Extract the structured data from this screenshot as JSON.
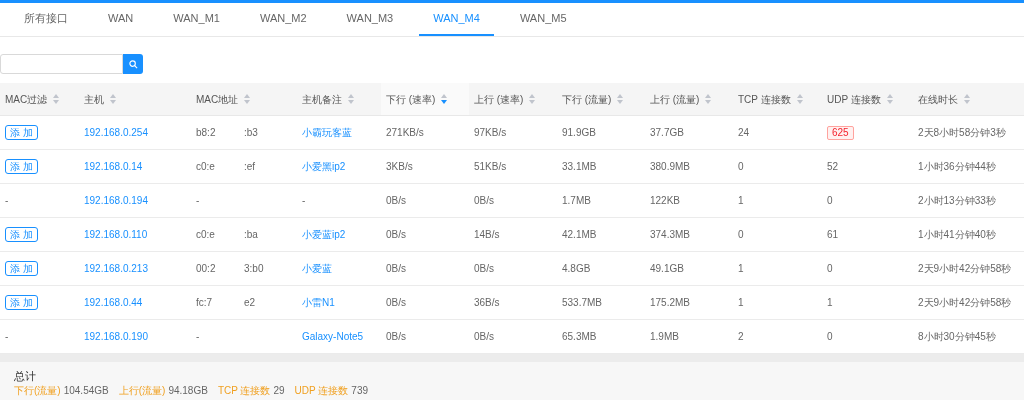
{
  "tabs": [
    {
      "label": "所有接口",
      "selected": false
    },
    {
      "label": "WAN",
      "selected": false
    },
    {
      "label": "WAN_M1",
      "selected": false
    },
    {
      "label": "WAN_M2",
      "selected": false
    },
    {
      "label": "WAN_M3",
      "selected": false
    },
    {
      "label": "WAN_M4",
      "selected": true
    },
    {
      "label": "WAN_M5",
      "selected": false
    }
  ],
  "table": {
    "columns": [
      {
        "label": "MAC过滤",
        "sorted": false
      },
      {
        "label": "主机",
        "sorted": false
      },
      {
        "label": "MAC地址",
        "sorted": false
      },
      {
        "label": "主机备注",
        "sorted": false
      },
      {
        "label": "下行 (速率)",
        "sorted": true
      },
      {
        "label": "上行 (速率)",
        "sorted": false
      },
      {
        "label": "下行 (流量)",
        "sorted": false
      },
      {
        "label": "上行 (流量)",
        "sorted": false
      },
      {
        "label": "TCP 连接数",
        "sorted": false
      },
      {
        "label": "UDP 连接数",
        "sorted": false
      },
      {
        "label": "在线时长",
        "sorted": false
      }
    ],
    "rows": [
      {
        "filter": {
          "kind": "button",
          "label": "添 加"
        },
        "host": "192.168.0.254",
        "mac": [
          "b8:2",
          ":b3"
        ],
        "note": "小霸玩客蓝",
        "down_rate": "271KB/s",
        "up_rate": "97KB/s",
        "down_total": "91.9GB",
        "up_total": "37.7GB",
        "tcp": "24",
        "udp": {
          "kind": "badge",
          "label": "625"
        },
        "online": "2天8小时58分钟3秒"
      },
      {
        "filter": {
          "kind": "button",
          "label": "添 加"
        },
        "host": "192.168.0.14",
        "mac": [
          "c0:e",
          ":ef"
        ],
        "note": "小爱黑ip2",
        "down_rate": "3KB/s",
        "up_rate": "51KB/s",
        "down_total": "33.1MB",
        "up_total": "380.9MB",
        "tcp": "0",
        "udp": {
          "kind": "text",
          "label": "52"
        },
        "online": "1小时36分钟44秒"
      },
      {
        "filter": {
          "kind": "text",
          "label": "-"
        },
        "host": "192.168.0.194",
        "mac": [
          "-"
        ],
        "note": "-",
        "down_rate": "0B/s",
        "up_rate": "0B/s",
        "down_total": "1.7MB",
        "up_total": "122KB",
        "tcp": "1",
        "udp": {
          "kind": "text",
          "label": "0"
        },
        "online": "2小时13分钟33秒"
      },
      {
        "filter": {
          "kind": "button",
          "label": "添 加"
        },
        "host": "192.168.0.110",
        "mac": [
          "c0:e",
          ":ba"
        ],
        "note": "小爱蓝ip2",
        "down_rate": "0B/s",
        "up_rate": "14B/s",
        "down_total": "42.1MB",
        "up_total": "374.3MB",
        "tcp": "0",
        "udp": {
          "kind": "text",
          "label": "61"
        },
        "online": "1小时41分钟40秒"
      },
      {
        "filter": {
          "kind": "button",
          "label": "添 加"
        },
        "host": "192.168.0.213",
        "mac": [
          "00:2",
          "3:b0"
        ],
        "note": "小爱蓝",
        "down_rate": "0B/s",
        "up_rate": "0B/s",
        "down_total": "4.8GB",
        "up_total": "49.1GB",
        "tcp": "1",
        "udp": {
          "kind": "text",
          "label": "0"
        },
        "online": "2天9小时42分钟58秒"
      },
      {
        "filter": {
          "kind": "button",
          "label": "添 加"
        },
        "host": "192.168.0.44",
        "mac": [
          "fc:7",
          "e2"
        ],
        "note": "小雷N1",
        "down_rate": "0B/s",
        "up_rate": "36B/s",
        "down_total": "533.7MB",
        "up_total": "175.2MB",
        "tcp": "1",
        "udp": {
          "kind": "text",
          "label": "1"
        },
        "online": "2天9小时42分钟58秒"
      },
      {
        "filter": {
          "kind": "text",
          "label": "-"
        },
        "host": "192.168.0.190",
        "mac": [
          "-"
        ],
        "note": "Galaxy-Note5",
        "down_rate": "0B/s",
        "up_rate": "0B/s",
        "down_total": "65.3MB",
        "up_total": "1.9MB",
        "tcp": "2",
        "udp": {
          "kind": "text",
          "label": "0"
        },
        "online": "8小时30分钟45秒"
      }
    ]
  },
  "summary": {
    "title": "总计",
    "items": [
      {
        "label": "下行(流量)",
        "value": "104.54GB"
      },
      {
        "label": "上行(流量)",
        "value": "94.18GB"
      },
      {
        "label": "TCP 连接数",
        "value": "29"
      },
      {
        "label": "UDP 连接数",
        "value": "739"
      }
    ]
  }
}
